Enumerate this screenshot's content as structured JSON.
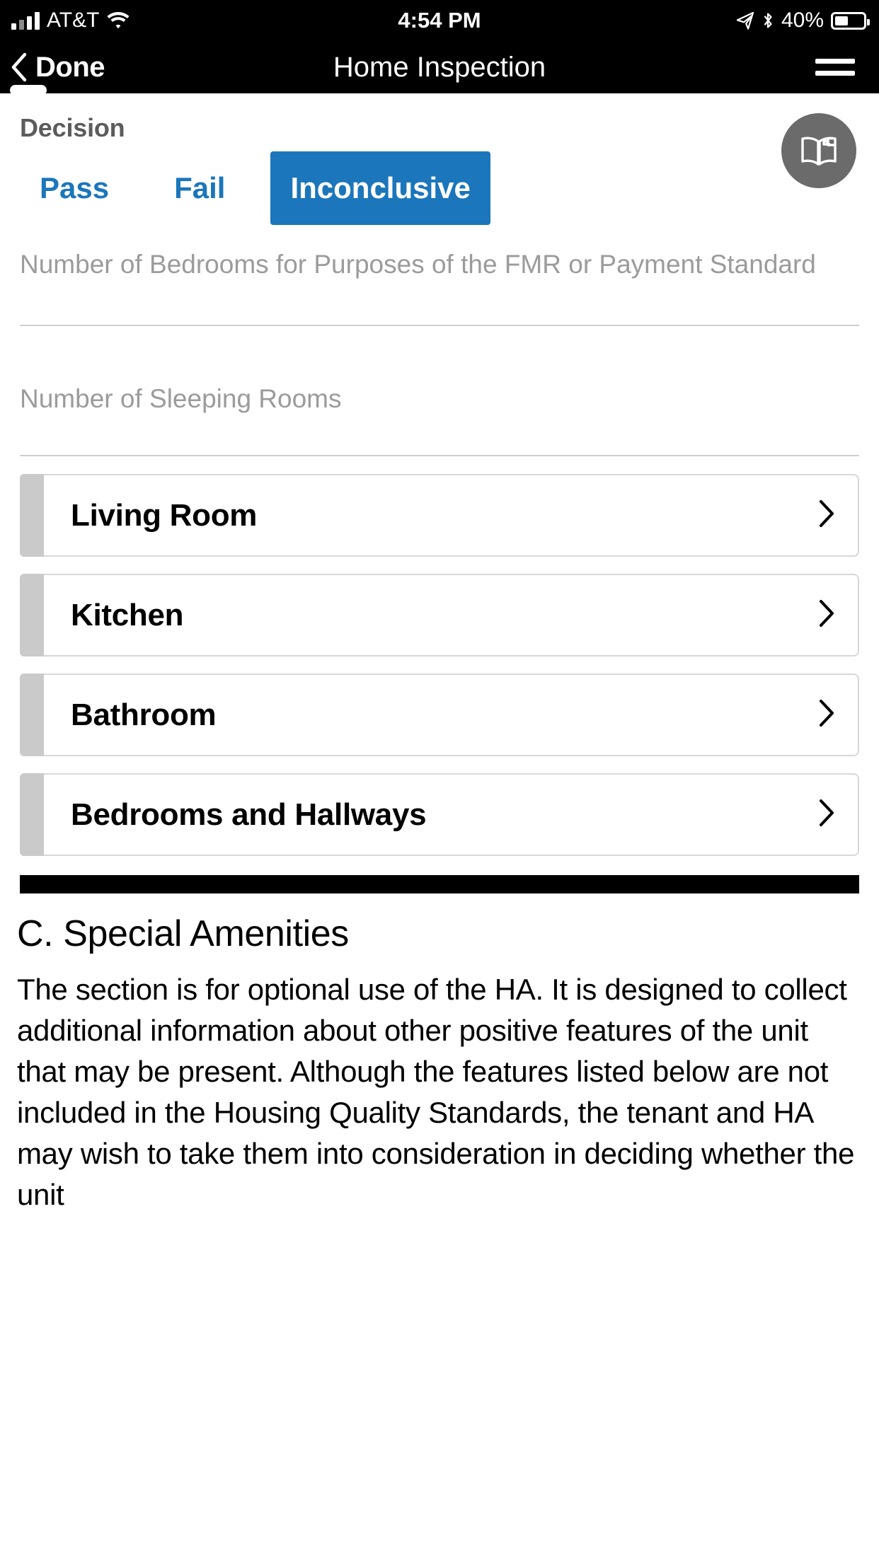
{
  "status_bar": {
    "carrier": "AT&T",
    "time": "4:54 PM",
    "battery_percent": "40%",
    "icons": {
      "signal": "signal-bars-icon",
      "wifi": "wifi-icon",
      "location": "location-arrow-icon",
      "bluetooth": "bluetooth-icon",
      "battery": "battery-icon"
    }
  },
  "nav_bar": {
    "back_label": "Done",
    "title": "Home Inspection",
    "menu_icon": "hamburger-menu-icon"
  },
  "decision": {
    "label": "Decision",
    "options": [
      {
        "label": "Pass",
        "selected": false
      },
      {
        "label": "Fail",
        "selected": false
      },
      {
        "label": "Inconclusive",
        "selected": true
      }
    ],
    "accent_color": "#1b76bb",
    "inactive_text_color": "#1b76bb"
  },
  "reference_button": {
    "icon": "open-book-icon",
    "background_color": "#6b6b6b"
  },
  "fields": [
    {
      "placeholder": "Number of Bedrooms for Purposes of the FMR or Payment Standard",
      "value": ""
    },
    {
      "placeholder": "Number of Sleeping Rooms",
      "value": ""
    }
  ],
  "room_cards": [
    {
      "title": "Living Room",
      "chevron": "chevron-right-icon"
    },
    {
      "title": "Kitchen",
      "chevron": "chevron-right-icon"
    },
    {
      "title": "Bathroom",
      "chevron": "chevron-right-icon"
    },
    {
      "title": "Bedrooms and Hallways",
      "chevron": "chevron-right-icon"
    }
  ],
  "special_amenities": {
    "heading": "C. Special Amenities",
    "paragraph": "The section is for optional use of the HA. It is designed to collect additional information about other positive features of the unit that may be present. Although the features listed below are not included in the Housing Quality Standards, the tenant and HA may wish to take them into consideration in deciding whether the unit"
  }
}
